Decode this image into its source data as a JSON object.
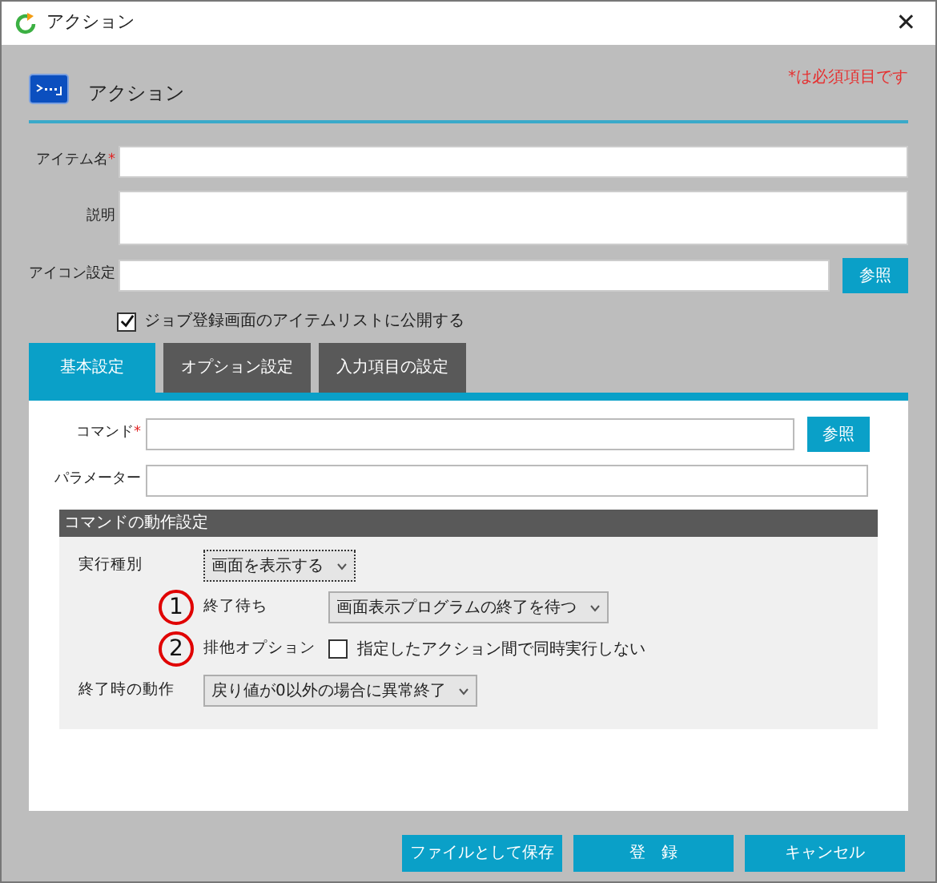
{
  "window": {
    "title": "アクション",
    "close": "✕"
  },
  "header": {
    "title": "アクション",
    "required_note": "*は必須項目です"
  },
  "fields": [
    {
      "kind": "line",
      "label": "アイテム名",
      "required_mark": "*"
    },
    {
      "kind": "area",
      "label": "説明"
    },
    {
      "kind": "browse",
      "label": "アイコン設定",
      "button": "参照"
    }
  ],
  "publish": {
    "label": "ジョブ登録画面のアイテムリストに公開する",
    "checked": true
  },
  "tabs": [
    {
      "label": "基本設定",
      "selected": true
    },
    {
      "label": "オプション設定",
      "selected": false
    },
    {
      "label": "入力項目の設定",
      "selected": false
    }
  ],
  "basic": {
    "fields": [
      {
        "kind": "browse",
        "label": "コマンド",
        "required_mark": "*",
        "button": "参照"
      },
      {
        "kind": "line",
        "label": "パラメーター"
      }
    ],
    "section": {
      "title": "コマンドの動作設定",
      "rows": [
        {
          "kind": "select",
          "label": "実行種別",
          "value": "画面を表示する",
          "focused": true
        },
        {
          "kind": "select",
          "label": "終了待ち",
          "value": "画面表示プログラムの終了を待つ",
          "marker": "1",
          "focused": false
        },
        {
          "kind": "checkbox",
          "label": "排他オプション",
          "option": "指定したアクション間で同時実行しない",
          "checked": false,
          "marker": "2"
        },
        {
          "kind": "select",
          "label": "終了時の動作",
          "value": "戻り値が0以外の場合に異常終了",
          "focused": false
        }
      ]
    }
  },
  "buttons": [
    "ファイルとして保存",
    "登　録",
    "キャンセル"
  ]
}
